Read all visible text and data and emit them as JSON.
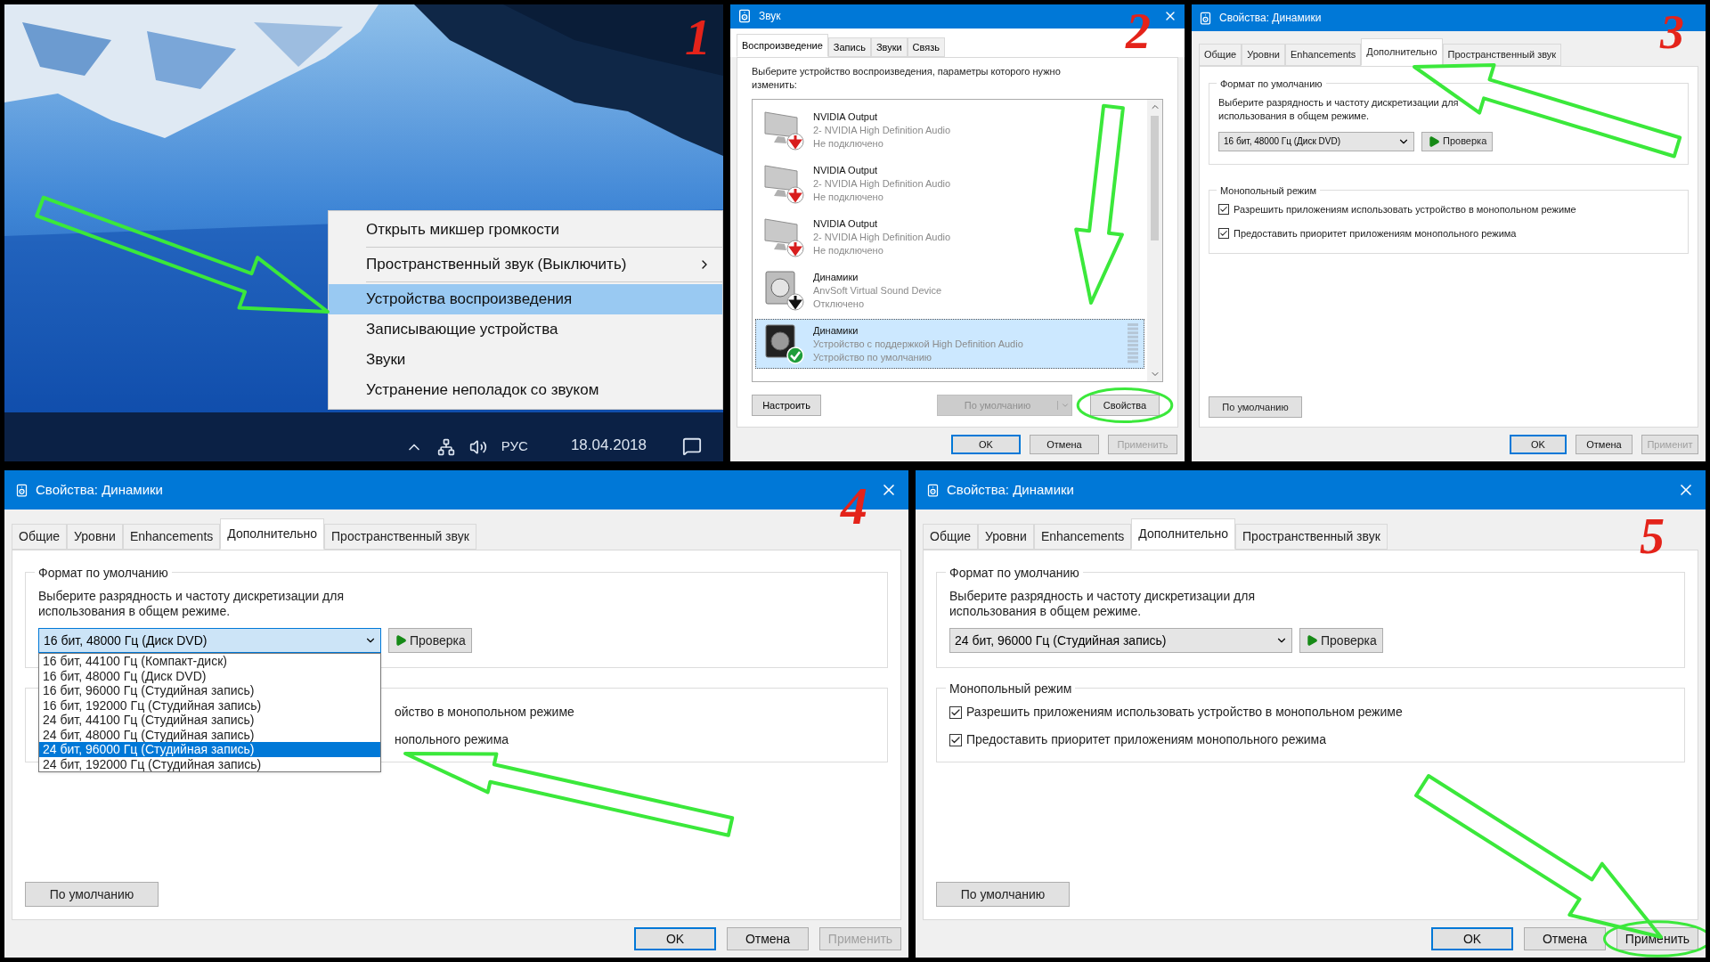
{
  "desktop": {
    "step": "1",
    "menu": [
      {
        "label": "Открыть микшер громкости",
        "selected": false,
        "submenu": false
      },
      {
        "label": "Пространственный звук (Выключить)",
        "selected": false,
        "submenu": true
      },
      {
        "label": "Устройства воспроизведения",
        "selected": true,
        "submenu": false
      },
      {
        "label": "Записывающие устройства",
        "selected": false,
        "submenu": false
      },
      {
        "label": "Звуки",
        "selected": false,
        "submenu": false
      },
      {
        "label": "Устранение неполадок со звуком",
        "selected": false,
        "submenu": false
      }
    ],
    "taskbar": {
      "language": "РУС",
      "date": "18.04.2018"
    }
  },
  "sound_dialog": {
    "step": "2",
    "title": "Звук",
    "tabs": [
      {
        "label": "Воспроизведение",
        "selected": true
      },
      {
        "label": "Запись",
        "selected": false
      },
      {
        "label": "Звуки",
        "selected": false
      },
      {
        "label": "Связь",
        "selected": false
      }
    ],
    "instruction_lines": [
      "Выберите устройство воспроизведения, параметры которого нужно",
      "изменить:"
    ],
    "devices": [
      {
        "name": "NVIDIA Output",
        "description": "2- NVIDIA High Definition Audio",
        "status": "Не подключено",
        "kind": "monitor_disconnected",
        "selected": false
      },
      {
        "name": "NVIDIA Output",
        "description": "2- NVIDIA High Definition Audio",
        "status": "Не подключено",
        "kind": "monitor_disconnected",
        "selected": false
      },
      {
        "name": "NVIDIA Output",
        "description": "2- NVIDIA High Definition Audio",
        "status": "Не подключено",
        "kind": "monitor_disconnected",
        "selected": false
      },
      {
        "name": "Динамики",
        "description": "AnvSoft Virtual Sound Device",
        "status": "Отключено",
        "kind": "speaker_disabled",
        "selected": false
      },
      {
        "name": "Динамики",
        "description": "Устройство с поддержкой High Definition Audio",
        "status": "Устройство по умолчанию",
        "kind": "speaker_default",
        "selected": true
      }
    ],
    "configure_button": "Настроить",
    "default_button": {
      "label": "По умолчанию",
      "disabled": true
    },
    "properties_button": {
      "label": "Свойства",
      "circled": true
    },
    "buttons": [
      {
        "label": "OK",
        "disabled": false,
        "focused": true,
        "circled": false
      },
      {
        "label": "Отмена",
        "disabled": false,
        "focused": false,
        "circled": false
      },
      {
        "label": "Применить",
        "disabled": true,
        "focused": false,
        "circled": false
      }
    ]
  },
  "properties_dialogs": [
    {
      "step": "3",
      "title": "Свойства: Динамики",
      "close_button": false,
      "tabs": [
        {
          "label": "Общие",
          "selected": false
        },
        {
          "label": "Уровни",
          "selected": false
        },
        {
          "label": "Enhancements",
          "selected": false
        },
        {
          "label": "Дополнительно",
          "selected": true
        },
        {
          "label": "Пространственный звук",
          "selected": false
        }
      ],
      "format_group": {
        "legend": "Формат по умолчанию",
        "description_lines": [
          "Выберите разрядность и частоту дискретизации для",
          "использования в общем режиме."
        ],
        "select_value": "16 бит, 48000 Гц (Диск DVD)",
        "expanded": false,
        "test_button": "Проверка"
      },
      "exclusive_group": {
        "legend": "Монопольный режим",
        "options": [
          {
            "kind": "checkbox",
            "label": "Разрешить приложениям использовать устройство в монопольном режиме",
            "checked": true
          },
          {
            "kind": "checkbox",
            "label": "Предоставить приоритет приложениям монопольного режима",
            "checked": true
          }
        ]
      },
      "defaults_button": "По умолчанию",
      "buttons": [
        {
          "label": "OK",
          "disabled": false,
          "focused": true,
          "circled": false
        },
        {
          "label": "Отмена",
          "disabled": false,
          "focused": false,
          "circled": false
        },
        {
          "label": "Применит",
          "disabled": true,
          "focused": false,
          "circled": false
        }
      ]
    },
    {
      "step": "4",
      "title": "Свойства: Динамики",
      "close_button": true,
      "tabs": [
        {
          "label": "Общие",
          "selected": false
        },
        {
          "label": "Уровни",
          "selected": false
        },
        {
          "label": "Enhancements",
          "selected": false
        },
        {
          "label": "Дополнительно",
          "selected": true
        },
        {
          "label": "Пространственный звук",
          "selected": false
        }
      ],
      "format_group": {
        "legend": "Формат по умолчанию",
        "description_lines": [
          "Выберите разрядность и частоту дискретизации для",
          "использования в общем режиме."
        ],
        "select_value": "16 бит, 48000 Гц (Диск DVD)",
        "expanded": true,
        "test_button": "Проверка",
        "options": [
          {
            "label": "16 бит, 44100 Гц (Компакт-диск)",
            "selected": false
          },
          {
            "label": "16 бит, 48000 Гц (Диск DVD)",
            "selected": false
          },
          {
            "label": "16 бит, 96000 Гц (Студийная запись)",
            "selected": false
          },
          {
            "label": "16 бит, 192000 Гц (Студийная запись)",
            "selected": false
          },
          {
            "label": "24 бит, 44100 Гц (Студийная запись)",
            "selected": false
          },
          {
            "label": "24 бит, 48000 Гц (Студийная запись)",
            "selected": false
          },
          {
            "label": "24 бит, 96000 Гц (Студийная запись)",
            "selected": true
          },
          {
            "label": "24 бит, 192000 Гц (Студийная запись)",
            "selected": false
          }
        ]
      },
      "exclusive_group": {
        "options": [
          {
            "kind": "fragment",
            "label": "ойство в монопольном режиме"
          },
          {
            "kind": "fragment",
            "label": "нопольного режима"
          }
        ]
      },
      "defaults_button": "По умолчанию",
      "buttons": [
        {
          "label": "OK",
          "disabled": false,
          "focused": true,
          "circled": false
        },
        {
          "label": "Отмена",
          "disabled": false,
          "focused": false,
          "circled": false
        },
        {
          "label": "Применить",
          "disabled": true,
          "focused": false,
          "circled": false
        }
      ]
    },
    {
      "step": "5",
      "title": "Свойства: Динамики",
      "close_button": true,
      "tabs": [
        {
          "label": "Общие",
          "selected": false
        },
        {
          "label": "Уровни",
          "selected": false
        },
        {
          "label": "Enhancements",
          "selected": false
        },
        {
          "label": "Дополнительно",
          "selected": true
        },
        {
          "label": "Пространственный звук",
          "selected": false
        }
      ],
      "format_group": {
        "legend": "Формат по умолчанию",
        "description_lines": [
          "Выберите разрядность и частоту дискретизации для",
          "использования в общем режиме."
        ],
        "select_value": "24 бит, 96000 Гц (Студийная запись)",
        "expanded": false,
        "test_button": "Проверка"
      },
      "exclusive_group": {
        "legend": "Монопольный режим",
        "options": [
          {
            "kind": "checkbox",
            "label": "Разрешить приложениям использовать устройство в монопольном режиме",
            "checked": true
          },
          {
            "kind": "checkbox",
            "label": "Предоставить приоритет приложениям монопольного режима",
            "checked": true
          }
        ]
      },
      "defaults_button": "По умолчанию",
      "buttons": [
        {
          "label": "OK",
          "disabled": false,
          "focused": true,
          "circled": false
        },
        {
          "label": "Отмена",
          "disabled": false,
          "focused": false,
          "circled": false
        },
        {
          "label": "Применить",
          "disabled": false,
          "focused": false,
          "circled": true
        }
      ]
    }
  ]
}
